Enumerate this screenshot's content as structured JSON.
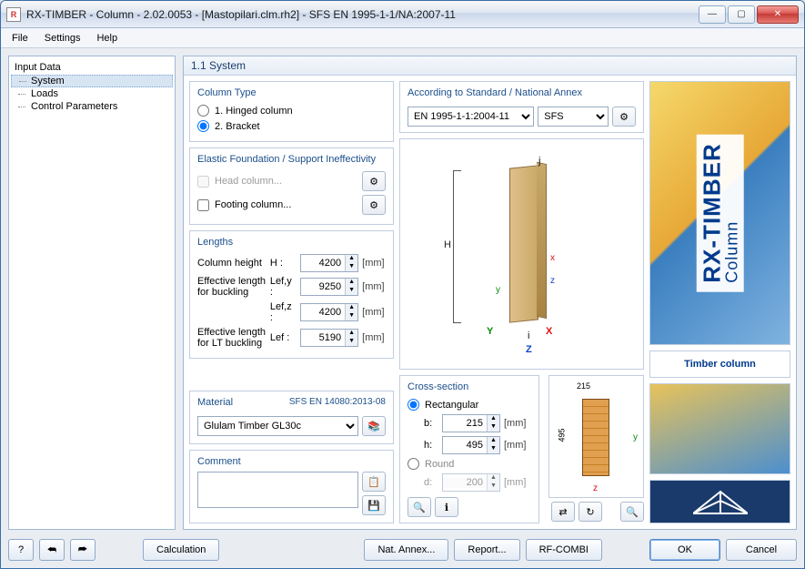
{
  "window": {
    "title": "RX-TIMBER - Column - 2.02.0053 - [Mastopilari.clm.rh2] - SFS EN 1995-1-1/NA:2007-11"
  },
  "menu": {
    "file": "File",
    "settings": "Settings",
    "help": "Help"
  },
  "tree": {
    "root": "Input Data",
    "items": [
      "System",
      "Loads",
      "Control Parameters"
    ],
    "selected": 0
  },
  "section": {
    "heading": "1.1 System"
  },
  "columnType": {
    "title": "Column Type",
    "opt1": "1. Hinged column",
    "opt2": "2. Bracket",
    "selected": 2
  },
  "elastic": {
    "title": "Elastic Foundation / Support Ineffectivity",
    "head": "Head column...",
    "foot": "Footing column..."
  },
  "lengths": {
    "title": "Lengths",
    "colHeight_lab": "Column height",
    "H_sym": "H :",
    "H_val": "4200",
    "effBuck_lab": "Effective length for buckling",
    "Lefy_sym": "Lef,y :",
    "Lefy_val": "9250",
    "Lefz_sym": "Lef,z :",
    "Lefz_val": "4200",
    "effLT_lab": "Effective length for LT buckling",
    "Lef_sym": "Lef :",
    "Lef_val": "5190",
    "unit": "[mm]"
  },
  "material": {
    "title": "Material",
    "std": "SFS EN 14080:2013-08",
    "value": "Glulam Timber GL30c"
  },
  "comment": {
    "title": "Comment",
    "value": ""
  },
  "standard": {
    "title": "According to Standard / National Annex",
    "code": "EN 1995-1-1:2004-11",
    "na": "SFS"
  },
  "crossSection": {
    "title": "Cross-section",
    "rect": "Rectangular",
    "round": "Round",
    "b_lab": "b:",
    "b_val": "215",
    "h_lab": "h:",
    "h_val": "495",
    "d_lab": "d:",
    "d_val": "200",
    "unit": "[mm]",
    "miniTop": "215",
    "miniLeft": "495"
  },
  "diagram": {
    "H": "H",
    "i": "i",
    "j": "j",
    "x": "x",
    "y": "y",
    "z": "z",
    "X": "X",
    "Y": "Y",
    "Z": "Z"
  },
  "brand": {
    "line1": "RX-TIMBER",
    "line2": "Column",
    "caption": "Timber column"
  },
  "footer": {
    "calc": "Calculation",
    "natAnnex": "Nat. Annex...",
    "report": "Report...",
    "rfcombi": "RF-COMBI",
    "ok": "OK",
    "cancel": "Cancel"
  }
}
